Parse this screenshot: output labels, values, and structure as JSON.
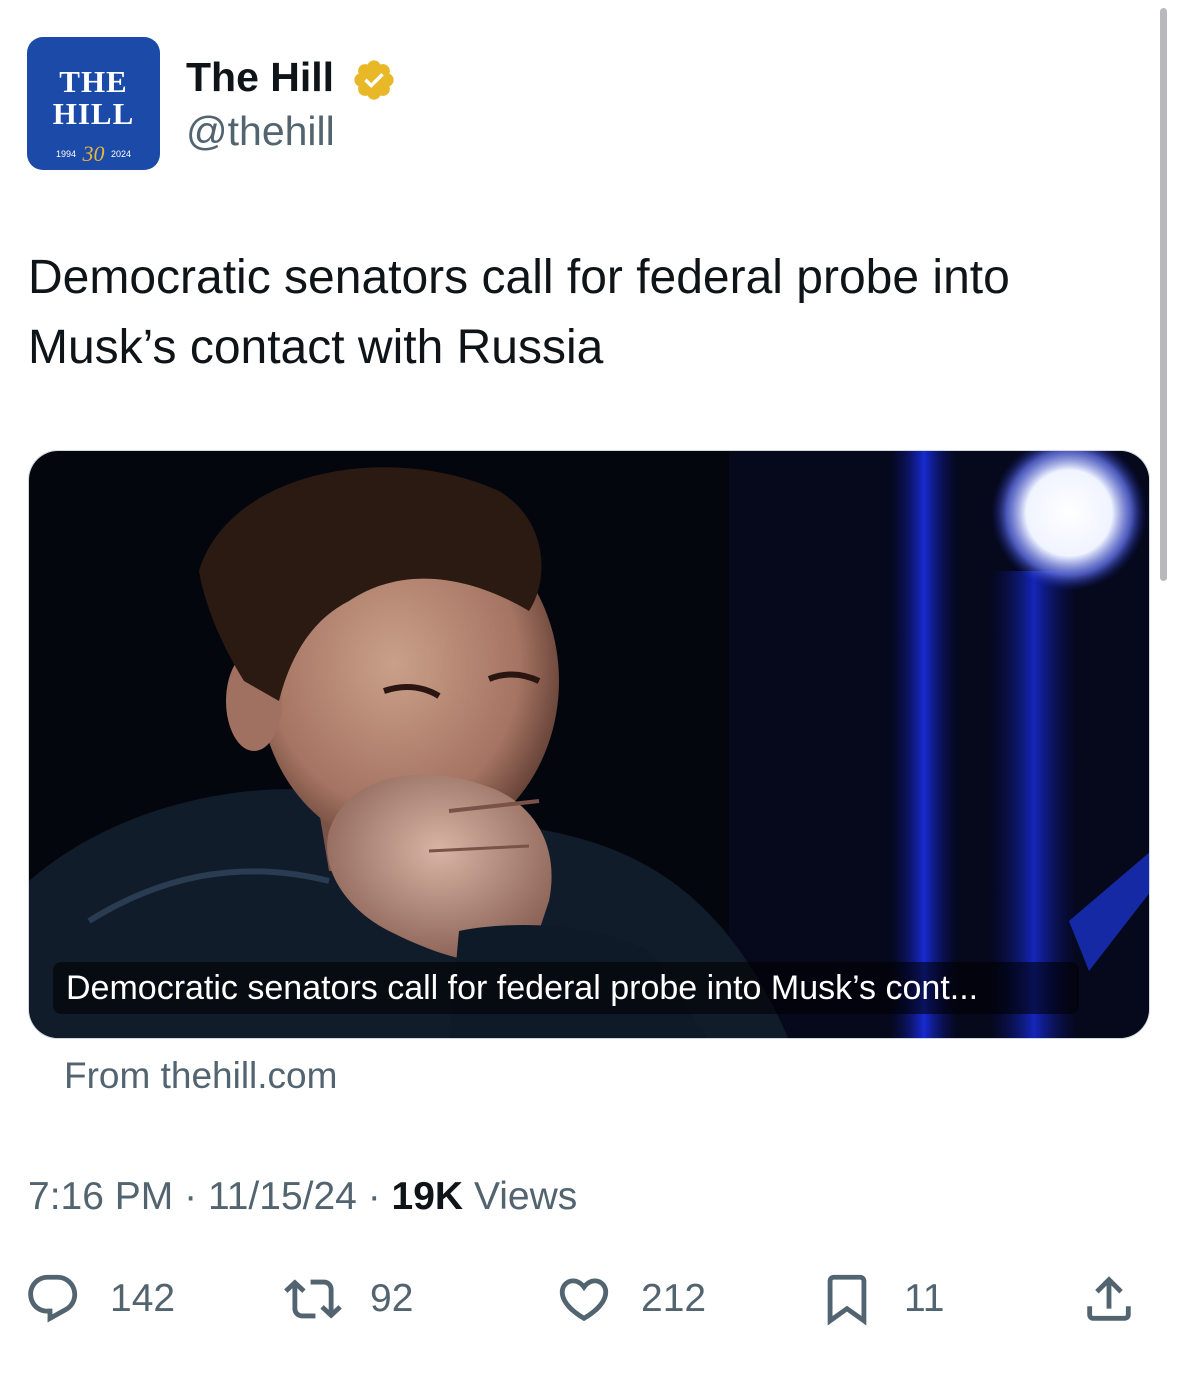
{
  "author": {
    "avatar": {
      "line1": "THE",
      "line2": "HILL",
      "year_start": "1994",
      "anniversary": "30",
      "year_end": "2024"
    },
    "display_name": "The Hill",
    "handle": "@thehill",
    "verified_icon": "verified-badge-gold"
  },
  "tweet": {
    "text": "Democratic senators call for federal probe into Musk’s contact with Russia"
  },
  "card": {
    "caption": "Democratic senators call for federal probe into Musk’s cont...",
    "source": "From thehill.com"
  },
  "meta": {
    "time": "7:16 PM",
    "sep1": "·",
    "date": "11/15/24",
    "sep2": "·",
    "views_count": "19K",
    "views_label": "Views"
  },
  "actions": {
    "reply": {
      "icon": "reply-icon",
      "count": "142"
    },
    "retweet": {
      "icon": "retweet-icon",
      "count": "92"
    },
    "like": {
      "icon": "heart-icon",
      "count": "212"
    },
    "bookmark": {
      "icon": "bookmark-icon",
      "count": "11"
    },
    "share": {
      "icon": "share-icon"
    }
  },
  "colors": {
    "text_primary": "#0f1419",
    "text_secondary": "#536471",
    "avatar_bg": "#1b4aa8",
    "verified_gold": "#e8b829"
  }
}
